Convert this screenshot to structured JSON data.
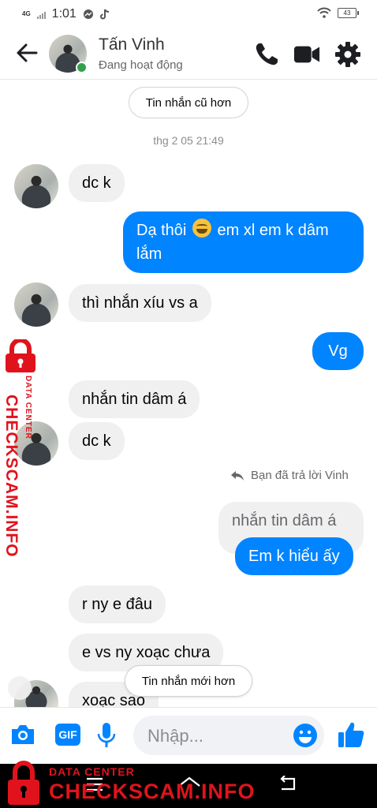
{
  "status_bar": {
    "network": "4G",
    "time": "1:01",
    "battery": "43"
  },
  "header": {
    "contact_name": "Tấn Vinh",
    "presence": "Đang hoạt động",
    "icons": [
      "back-arrow-icon",
      "phone-icon",
      "video-icon",
      "settings-gear-icon"
    ],
    "online_color": "#31a24c"
  },
  "conversation": {
    "older_messages_label": "Tin nhắn cũ hơn",
    "timestamp": "thg 2 05 21:49",
    "messages": [
      {
        "sender": "contact",
        "text": "dc k"
      },
      {
        "sender": "me",
        "text_before_emoji": "Dạ thôi",
        "emoji": "grinning-sweat-emoji",
        "text_after_emoji": "em xl em k dâm",
        "text_line2": "lắm"
      },
      {
        "sender": "contact",
        "text": "thì nhắn xíu vs a"
      },
      {
        "sender": "me",
        "text": "Vg"
      },
      {
        "sender": "contact",
        "text": "nhắn tin dâm á"
      },
      {
        "sender": "contact",
        "text": "dc k"
      },
      {
        "sender": "me",
        "reply_note": "Bạn đã trả lời Vinh",
        "quoted": "nhắn tin dâm á",
        "text": "Em k hiểu ấy"
      },
      {
        "sender": "contact",
        "text": "r ny e đâu"
      },
      {
        "sender": "contact",
        "text": "e vs ny xoạc chưa"
      },
      {
        "sender": "contact",
        "text": "xoạc sao"
      }
    ],
    "newer_messages_label": "Tin nhắn mới hơn"
  },
  "composer": {
    "placeholder": "Nhập...",
    "gif_label": "GIF",
    "icons": [
      "camera-icon",
      "gif-icon",
      "microphone-icon",
      "emoji-icon",
      "thumbs-up-icon"
    ]
  },
  "watermark": {
    "small": "DATA CENTER",
    "big": "CHECKSCAM.INFO"
  },
  "colors": {
    "accent": "#0084ff",
    "incoming_bubble": "#f0f0f0",
    "watermark": "#e0131c"
  }
}
